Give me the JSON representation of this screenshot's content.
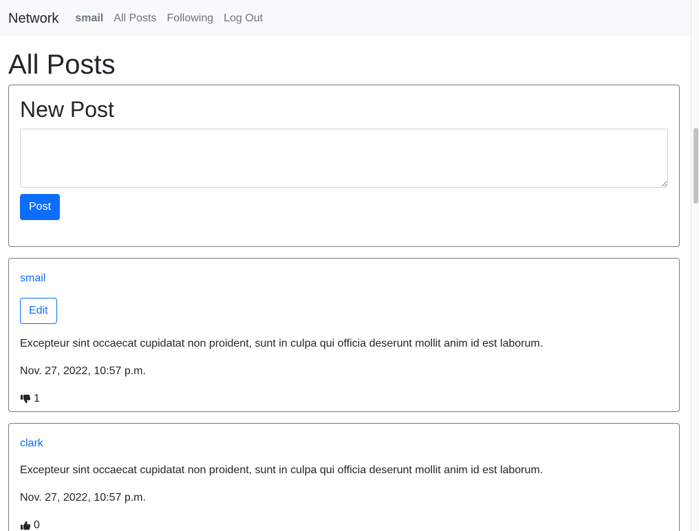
{
  "navbar": {
    "brand": "Network",
    "links": [
      {
        "label": "smail"
      },
      {
        "label": "All Posts"
      },
      {
        "label": "Following"
      },
      {
        "label": "Log Out"
      }
    ]
  },
  "page": {
    "title": "All Posts"
  },
  "new_post": {
    "title": "New Post",
    "textarea_value": "",
    "submit_label": "Post"
  },
  "posts": [
    {
      "username": "smail",
      "edit_label": "Edit",
      "content": "Excepteur sint occaecat cupidatat non proident, sunt in culpa qui officia deserunt mollit anim id est laborum.",
      "timestamp": "Nov. 27, 2022, 10:57 p.m.",
      "like_icon": "thumbs-down-icon",
      "likes": "1"
    },
    {
      "username": "clark",
      "content": "Excepteur sint occaecat cupidatat non proident, sunt in culpa qui officia deserunt mollit anim id est laborum.",
      "timestamp": "Nov. 27, 2022, 10:57 p.m.",
      "like_icon": "thumbs-up-icon",
      "likes": "0"
    }
  ],
  "colors": {
    "accent": "#0d6efd",
    "navbar_bg": "#f8f9fa",
    "muted": "#6c757d"
  }
}
